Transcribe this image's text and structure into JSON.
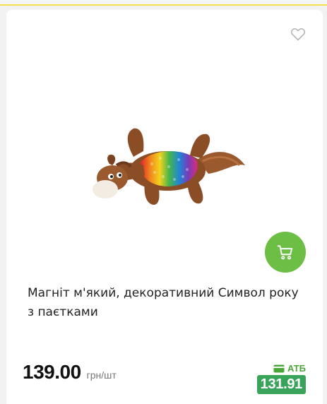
{
  "product": {
    "title": "Магніт м'який, декоративний Символ року з паєтками",
    "image_alt": "plush-horse-with-rainbow-sequins",
    "price": "139.00",
    "unit": "грн/шт",
    "atb_label": "АТБ",
    "atb_price": "131.91"
  },
  "icons": {
    "favorite": "heart-icon",
    "cart": "cart-icon",
    "wallet": "wallet-icon"
  },
  "colors": {
    "accent_yellow": "#f4e04d",
    "cart_green": "#6cbe45",
    "atb_green": "#3aa35a"
  }
}
